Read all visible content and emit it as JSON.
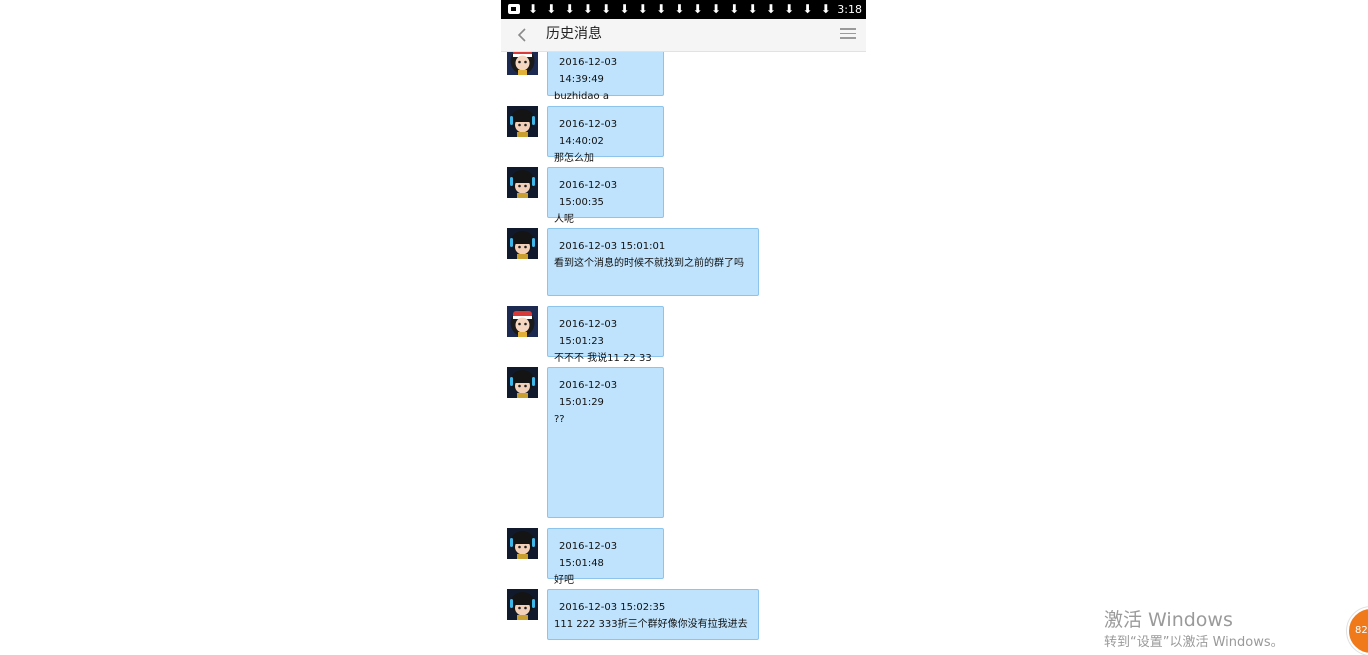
{
  "status_bar": {
    "time": "3:18",
    "download_icon_glyph": "⬇",
    "download_icon_count": 17
  },
  "header": {
    "title": "历史消息",
    "back_icon": "chevron-left-icon",
    "menu_icon": "hamburger-menu-icon"
  },
  "colors": {
    "bubble": "#bfe3fd",
    "bubble_border": "#8cc4ec",
    "status_bar": "#000000",
    "title_bar": "#f5f5f5"
  },
  "messages": [
    {
      "avatar": "girl-avatar",
      "timestamp": "2016-12-03 14:39:49",
      "text": "buzhidao a"
    },
    {
      "avatar": "boy-avatar",
      "timestamp": "2016-12-03 14:40:02",
      "text": "那怎么加"
    },
    {
      "avatar": "boy-avatar",
      "timestamp": "2016-12-03 15:00:35",
      "text": "人呢"
    },
    {
      "avatar": "boy-avatar",
      "timestamp": "2016-12-03 15:01:01",
      "text": "看到这个消息的时候不就找到之前的群了吗"
    },
    {
      "avatar": "girl-avatar",
      "timestamp": "2016-12-03 15:01:23",
      "text": "不不不 我说11 22 33"
    },
    {
      "avatar": "boy-avatar",
      "timestamp": "2016-12-03 15:01:29",
      "text": "??"
    },
    {
      "avatar": "boy-avatar",
      "timestamp": "2016-12-03 15:01:48",
      "text": "好吧"
    },
    {
      "avatar": "boy-avatar",
      "timestamp": "2016-12-03 15:02:35",
      "text": "111 222 333折三个群好像你没有拉我进去"
    }
  ],
  "watermark": {
    "line1": "激活 Windows",
    "line2": "转到“设置”以激活 Windows。"
  },
  "corner_badge": {
    "text": "82"
  }
}
